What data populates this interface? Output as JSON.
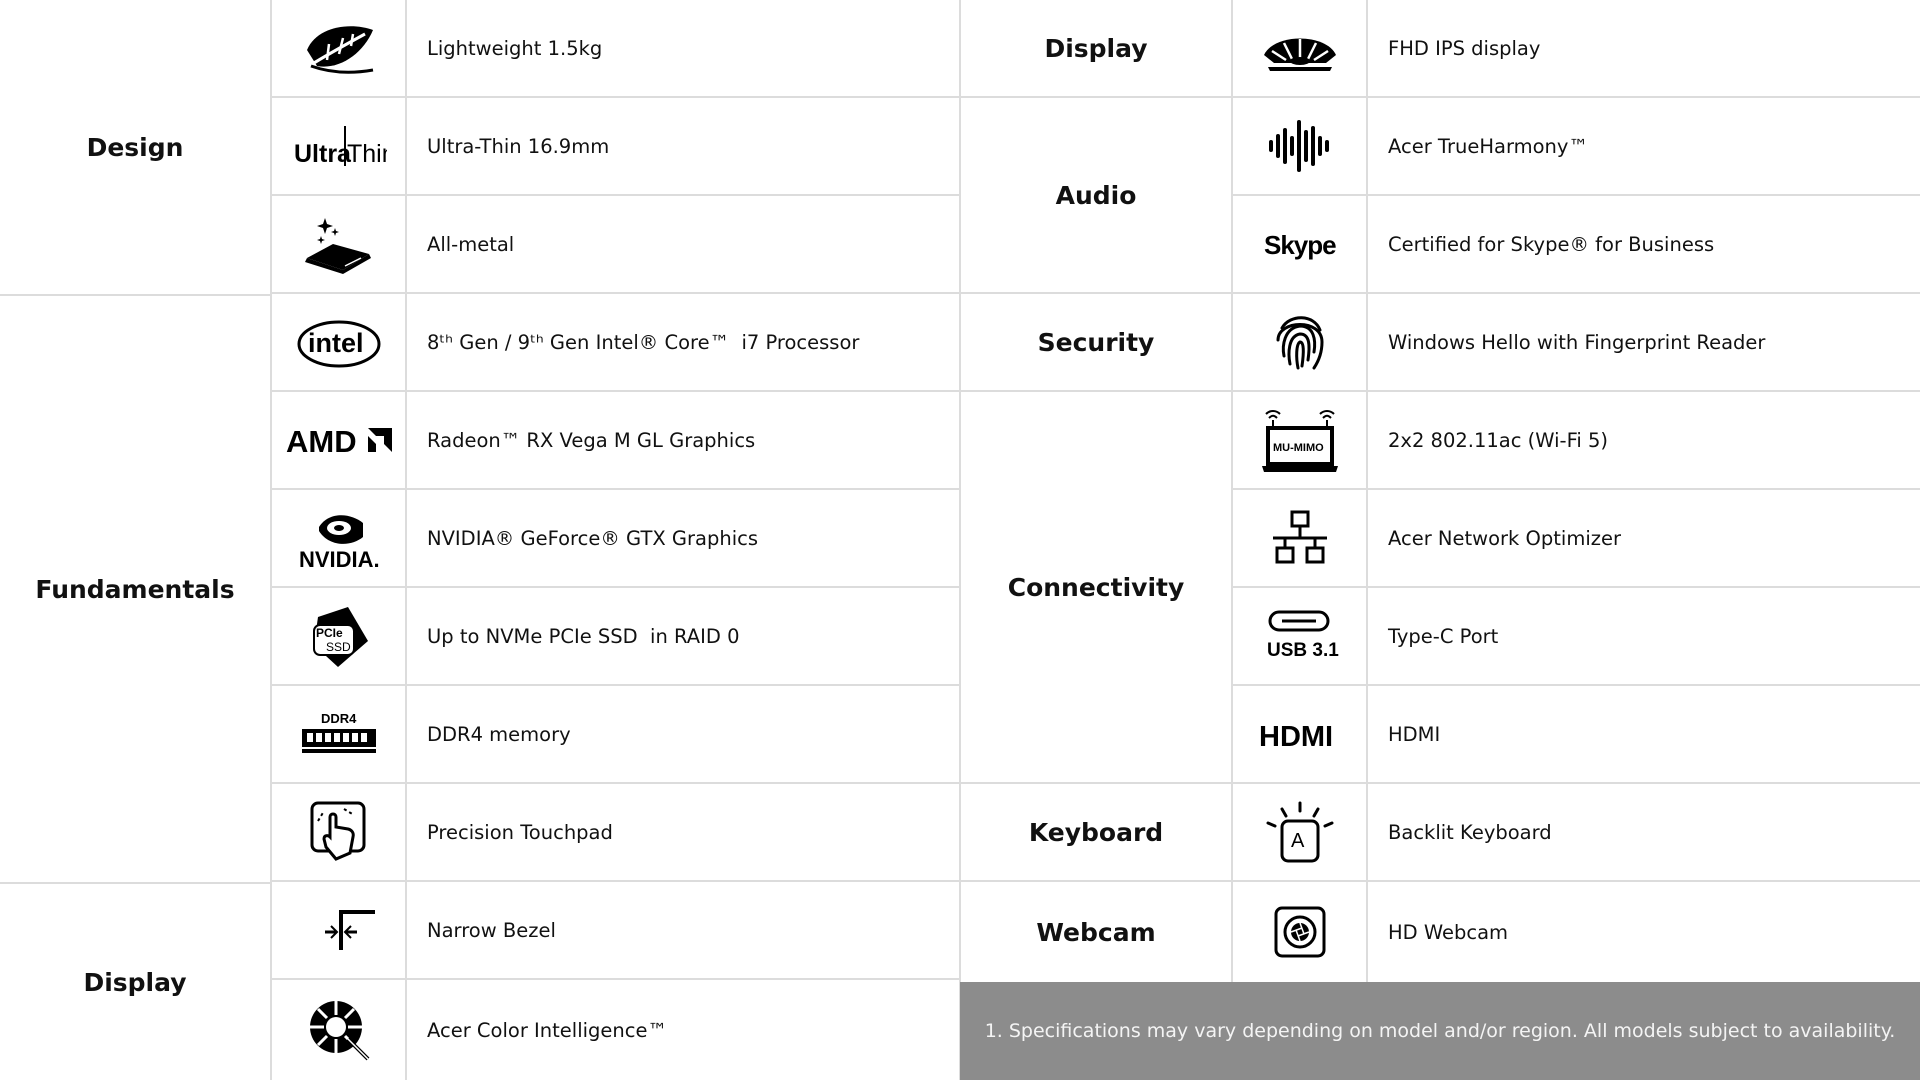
{
  "left_table": {
    "categories": [
      "Design",
      "Fundamentals",
      "Display"
    ],
    "rows": [
      {
        "icon": "leaf-icon",
        "text": "Lightweight 1.5kg"
      },
      {
        "icon": "ultra-thin-icon",
        "icon_text": "Ultra|Thin",
        "text": "Ultra-Thin 16.9mm"
      },
      {
        "icon": "laptop-sparkle-icon",
        "text": "All-metal"
      },
      {
        "icon": "intel-logo-icon",
        "icon_text": "intel",
        "text": "8ᵗʰ Gen / 9ᵗʰ Gen Intel® Core™  i7 Processor"
      },
      {
        "icon": "amd-logo-icon",
        "icon_text": "AMD",
        "text": "Radeon™ RX Vega M GL Graphics"
      },
      {
        "icon": "nvidia-logo-icon",
        "icon_text": "NVIDIA.",
        "text": "NVIDIA® GeForce® GTX Graphics"
      },
      {
        "icon": "pcie-ssd-icon",
        "icon_text": "PCIe SSD",
        "text": "Up to NVMe PCIe SSD  in RAID 0"
      },
      {
        "icon": "ddr4-memory-icon",
        "icon_text": "DDR4",
        "text": "DDR4 memory"
      },
      {
        "icon": "touchpad-hand-icon",
        "text": "Precision Touchpad"
      },
      {
        "icon": "narrow-bezel-icon",
        "text": "Narrow Bezel"
      },
      {
        "icon": "color-intelligence-icon",
        "text": "Acer Color Intelligence™"
      }
    ]
  },
  "right_table": {
    "categories": [
      "Display",
      "Audio",
      "Security",
      "Connectivity",
      "Keyboard",
      "Webcam"
    ],
    "rows": [
      {
        "icon": "display-arc-icon",
        "text": "FHD IPS display"
      },
      {
        "icon": "sound-wave-icon",
        "text": "Acer TrueHarmony™"
      },
      {
        "icon": "skype-logo-icon",
        "icon_text": "Skype",
        "text": "Certified for Skype® for Business"
      },
      {
        "icon": "fingerprint-icon",
        "text": "Windows Hello with Fingerprint Reader"
      },
      {
        "icon": "mu-mimo-icon",
        "icon_text": "MU-MIMO",
        "text": "2x2 802.11ac (Wi-Fi 5)"
      },
      {
        "icon": "network-icon",
        "text": "Acer Network Optimizer"
      },
      {
        "icon": "usb-c-icon",
        "icon_text": "USB 3.1",
        "text": "Type-C Port"
      },
      {
        "icon": "hdmi-logo-icon",
        "icon_text": "HDMI",
        "text": "HDMI"
      },
      {
        "icon": "backlit-key-icon",
        "icon_text": "A",
        "text": "Backlit Keyboard"
      },
      {
        "icon": "webcam-icon",
        "text": "HD Webcam"
      }
    ]
  },
  "footnote": "1. Specifications may vary depending on model and/or region. All models subject to availability."
}
